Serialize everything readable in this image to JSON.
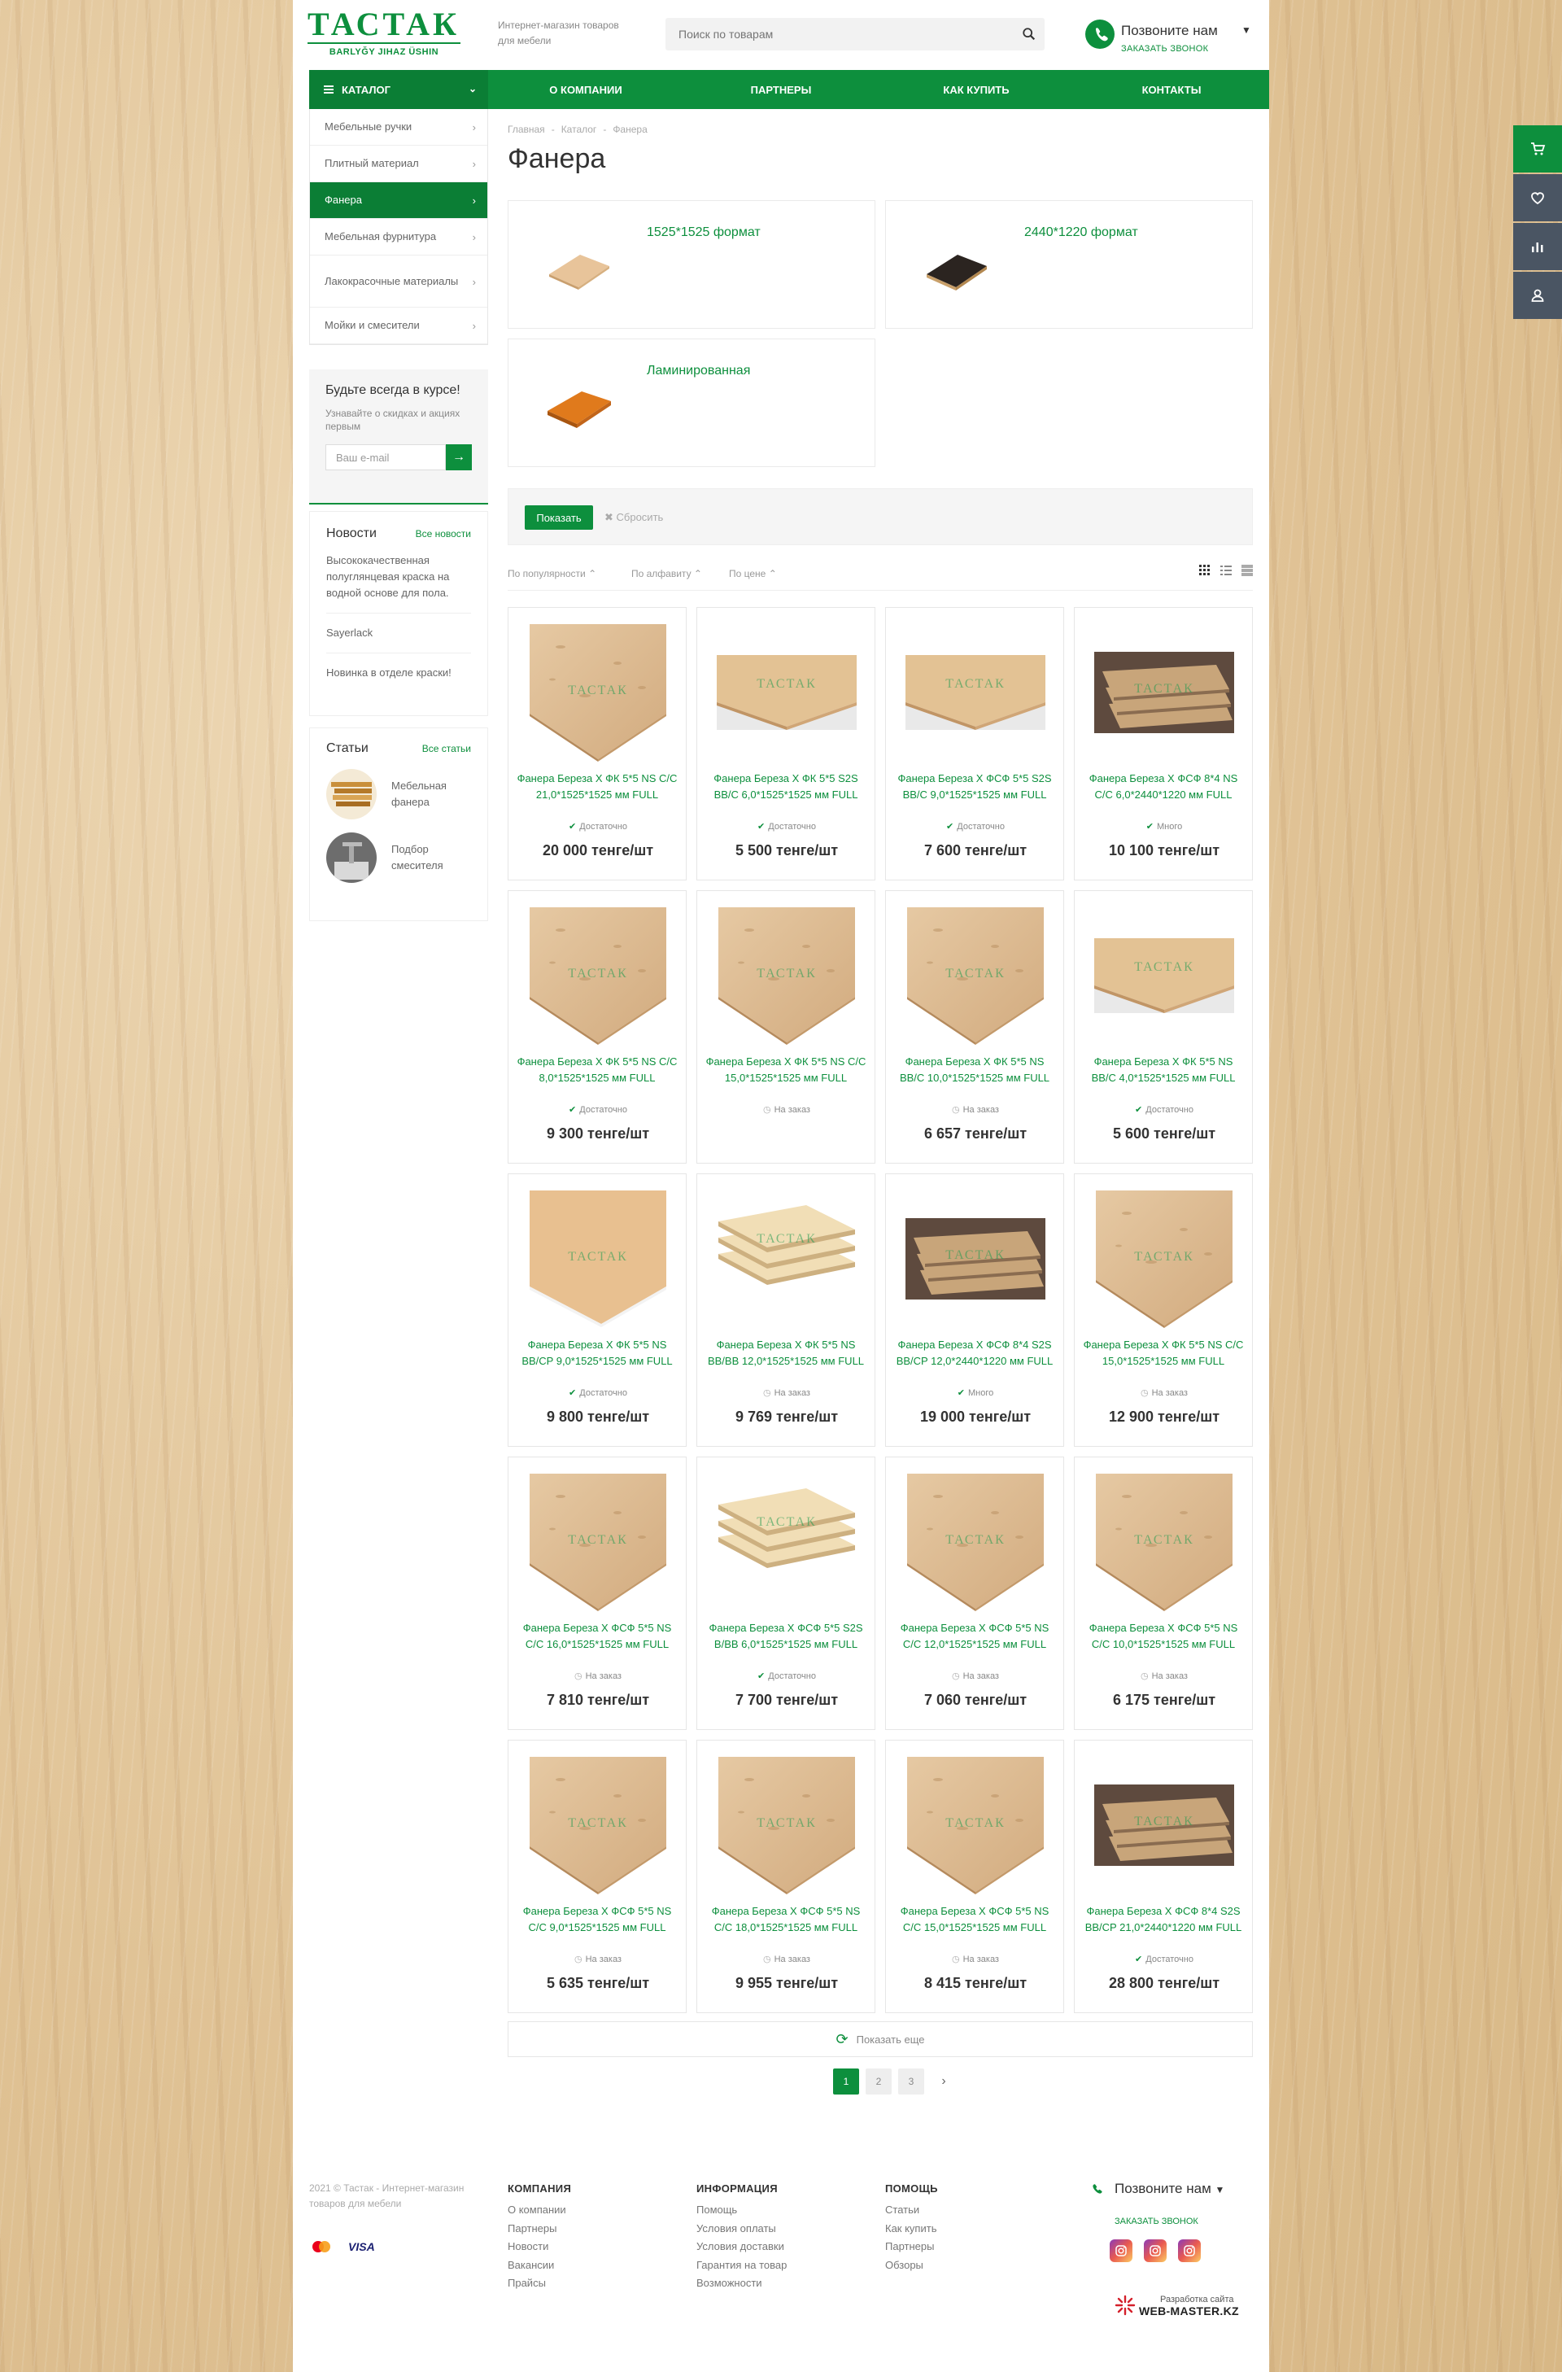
{
  "header": {
    "logo_main": "ТАСТАК",
    "logo_sub": "BARLYĞY JIHAZ ÜSHIN",
    "tagline": "Интернет-магазин товаров для мебели",
    "search_placeholder": "Поиск по товарам",
    "phone_title": "Позвоните нам",
    "phone_sub": "ЗАКАЗАТЬ ЗВОНОК"
  },
  "nav": {
    "catalog": "КАТАЛОГ",
    "items": [
      "О КОМПАНИИ",
      "ПАРТНЕРЫ",
      "КАК КУПИТЬ",
      "КОНТАКТЫ"
    ]
  },
  "sidebar": {
    "categories": [
      {
        "label": "Мебельные ручки",
        "active": false
      },
      {
        "label": "Плитный материал",
        "active": false
      },
      {
        "label": "Фанера",
        "active": true
      },
      {
        "label": "Мебельная фурнитура",
        "active": false
      },
      {
        "label": "Лакокрасочные материалы",
        "active": false
      },
      {
        "label": "Мойки и смесители",
        "active": false
      }
    ],
    "subscribe": {
      "title": "Будьте всегда в курсе!",
      "text": "Узнавайте о скидках и акциях первым",
      "placeholder": "Ваш e-mail",
      "go": "→"
    },
    "news": {
      "title": "Новости",
      "link": "Все новости",
      "items": [
        "Высококачественная полуглянцевая краска на водной основе для пола.",
        "Sayerlack",
        "Новинка в отделе краски!"
      ]
    },
    "articles": {
      "title": "Статьи",
      "link": "Все статьи",
      "items": [
        "Мебельная фанера",
        "Подбор смесителя"
      ]
    }
  },
  "main": {
    "breadcrumb": [
      "Главная",
      "-",
      "Каталог",
      "-",
      "Фанера"
    ],
    "title": "Фанера",
    "subcats": [
      "1525*1525 формат",
      "2440*1220 формат",
      "Ламинированная"
    ],
    "filter": {
      "show": "Показать",
      "reset": "Сбросить"
    },
    "sort": [
      "По популярности",
      "По алфавиту",
      "По цене"
    ],
    "more": "Показать еще",
    "pages": [
      "1",
      "2",
      "3"
    ]
  },
  "products": [
    {
      "name": "Фанера Береза Х ФК 5*5 NS C/C 21,0*1525*1525 мм FULL",
      "stock": "Достаточно",
      "in_stock": true,
      "price": "20 000 тенге/шт",
      "img": "sheet"
    },
    {
      "name": "Фанера Береза Х ФК 5*5 S2S BB/C 6,0*1525*1525 мм FULL",
      "stock": "Достаточно",
      "in_stock": true,
      "price": "5 500 тенге/шт",
      "img": "flat"
    },
    {
      "name": "Фанера Береза Х ФСФ 5*5 S2S BB/C 9,0*1525*1525 мм FULL",
      "stock": "Достаточно",
      "in_stock": true,
      "price": "7 600 тенге/шт",
      "img": "flat"
    },
    {
      "name": "Фанера Береза Х ФСФ 8*4 NS C/C 6,0*2440*1220 мм FULL",
      "stock": "Много",
      "in_stock": true,
      "price": "10 100 тенге/шт",
      "img": "dark"
    },
    {
      "name": "Фанера Береза Х ФК 5*5 NS C/C 8,0*1525*1525 мм FULL",
      "stock": "Достаточно",
      "in_stock": true,
      "price": "9 300 тенге/шт",
      "img": "sheet"
    },
    {
      "name": "Фанера Береза Х ФК 5*5 NS C/C 15,0*1525*1525 мм FULL",
      "stock": "На заказ",
      "in_stock": false,
      "price": "",
      "img": "sheet"
    },
    {
      "name": "Фанера Береза Х ФК 5*5 NS BB/C 10,0*1525*1525 мм FULL",
      "stock": "На заказ",
      "in_stock": false,
      "price": "6 657 тенге/шт",
      "img": "sheet"
    },
    {
      "name": "Фанера Береза Х ФК 5*5 NS BB/C 4,0*1525*1525 мм FULL",
      "stock": "Достаточно",
      "in_stock": true,
      "price": "5 600 тенге/шт",
      "img": "flat"
    },
    {
      "name": "Фанера Береза Х ФК 5*5 NS BB/CP 9,0*1525*1525 мм FULL",
      "stock": "Достаточно",
      "in_stock": true,
      "price": "9 800 тенге/шт",
      "img": "light"
    },
    {
      "name": "Фанера Береза Х ФК 5*5 NS BB/BB 12,0*1525*1525 мм FULL",
      "stock": "На заказ",
      "in_stock": false,
      "price": "9 769 тенге/шт",
      "img": "stack"
    },
    {
      "name": "Фанера Береза Х ФСФ 8*4 S2S BB/CP 12,0*2440*1220 мм FULL",
      "stock": "Много",
      "in_stock": true,
      "price": "19 000 тенге/шт",
      "img": "dark"
    },
    {
      "name": "Фанера Береза Х ФК 5*5 NS C/C 15,0*1525*1525 мм FULL",
      "stock": "На заказ",
      "in_stock": false,
      "price": "12 900 тенге/шт",
      "img": "sheet"
    },
    {
      "name": "Фанера Береза Х ФСФ 5*5 NS C/C 16,0*1525*1525 мм FULL",
      "stock": "На заказ",
      "in_stock": false,
      "price": "7 810 тенге/шт",
      "img": "sheet"
    },
    {
      "name": "Фанера Береза Х ФСФ 5*5 S2S B/BB 6,0*1525*1525 мм FULL",
      "stock": "Достаточно",
      "in_stock": true,
      "price": "7 700 тенге/шт",
      "img": "stack"
    },
    {
      "name": "Фанера Береза Х ФСФ 5*5 NS C/C 12,0*1525*1525 мм FULL",
      "stock": "На заказ",
      "in_stock": false,
      "price": "7 060 тенге/шт",
      "img": "sheet"
    },
    {
      "name": "Фанера Береза Х ФСФ 5*5 NS C/C 10,0*1525*1525 мм FULL",
      "stock": "На заказ",
      "in_stock": false,
      "price": "6 175 тенге/шт",
      "img": "sheet"
    },
    {
      "name": "Фанера Береза Х ФСФ 5*5 NS C/C 9,0*1525*1525 мм FULL",
      "stock": "На заказ",
      "in_stock": false,
      "price": "5 635 тенге/шт",
      "img": "sheet"
    },
    {
      "name": "Фанера Береза Х ФСФ 5*5 NS C/C 18,0*1525*1525 мм FULL",
      "stock": "На заказ",
      "in_stock": false,
      "price": "9 955 тенге/шт",
      "img": "sheet"
    },
    {
      "name": "Фанера Береза Х ФСФ 5*5 NS C/C 15,0*1525*1525 мм FULL",
      "stock": "На заказ",
      "in_stock": false,
      "price": "8 415 тенге/шт",
      "img": "sheet"
    },
    {
      "name": "Фанера Береза Х ФСФ 8*4 S2S BB/CP 21,0*2440*1220 мм FULL",
      "stock": "Достаточно",
      "in_stock": true,
      "price": "28 800 тенге/шт",
      "img": "dark"
    }
  ],
  "footer": {
    "copyright": "2021 © Тастак - Интернет-магазин товаров для мебели",
    "pay": [
      "VISA"
    ],
    "cols": [
      {
        "head": "КОМПАНИЯ",
        "links": [
          "О компании",
          "Партнеры",
          "Новости",
          "Вакансии",
          "Прайсы"
        ]
      },
      {
        "head": "ИНФОРМАЦИЯ",
        "links": [
          "Помощь",
          "Условия оплаты",
          "Условия доставки",
          "Гарантия на товар",
          "Возможности"
        ]
      },
      {
        "head": "ПОМОЩЬ",
        "links": [
          "Статьи",
          "Как купить",
          "Партнеры",
          "Обзоры"
        ]
      }
    ],
    "phone_title": "Позвоните нам",
    "phone_sub": "ЗАКАЗАТЬ ЗВОНОК",
    "dev_small": "Разработка сайта",
    "dev_big": "WEB-MASTER.KZ"
  },
  "colors": {
    "brand": "#0d8f3d",
    "panel": "#4a5563"
  }
}
